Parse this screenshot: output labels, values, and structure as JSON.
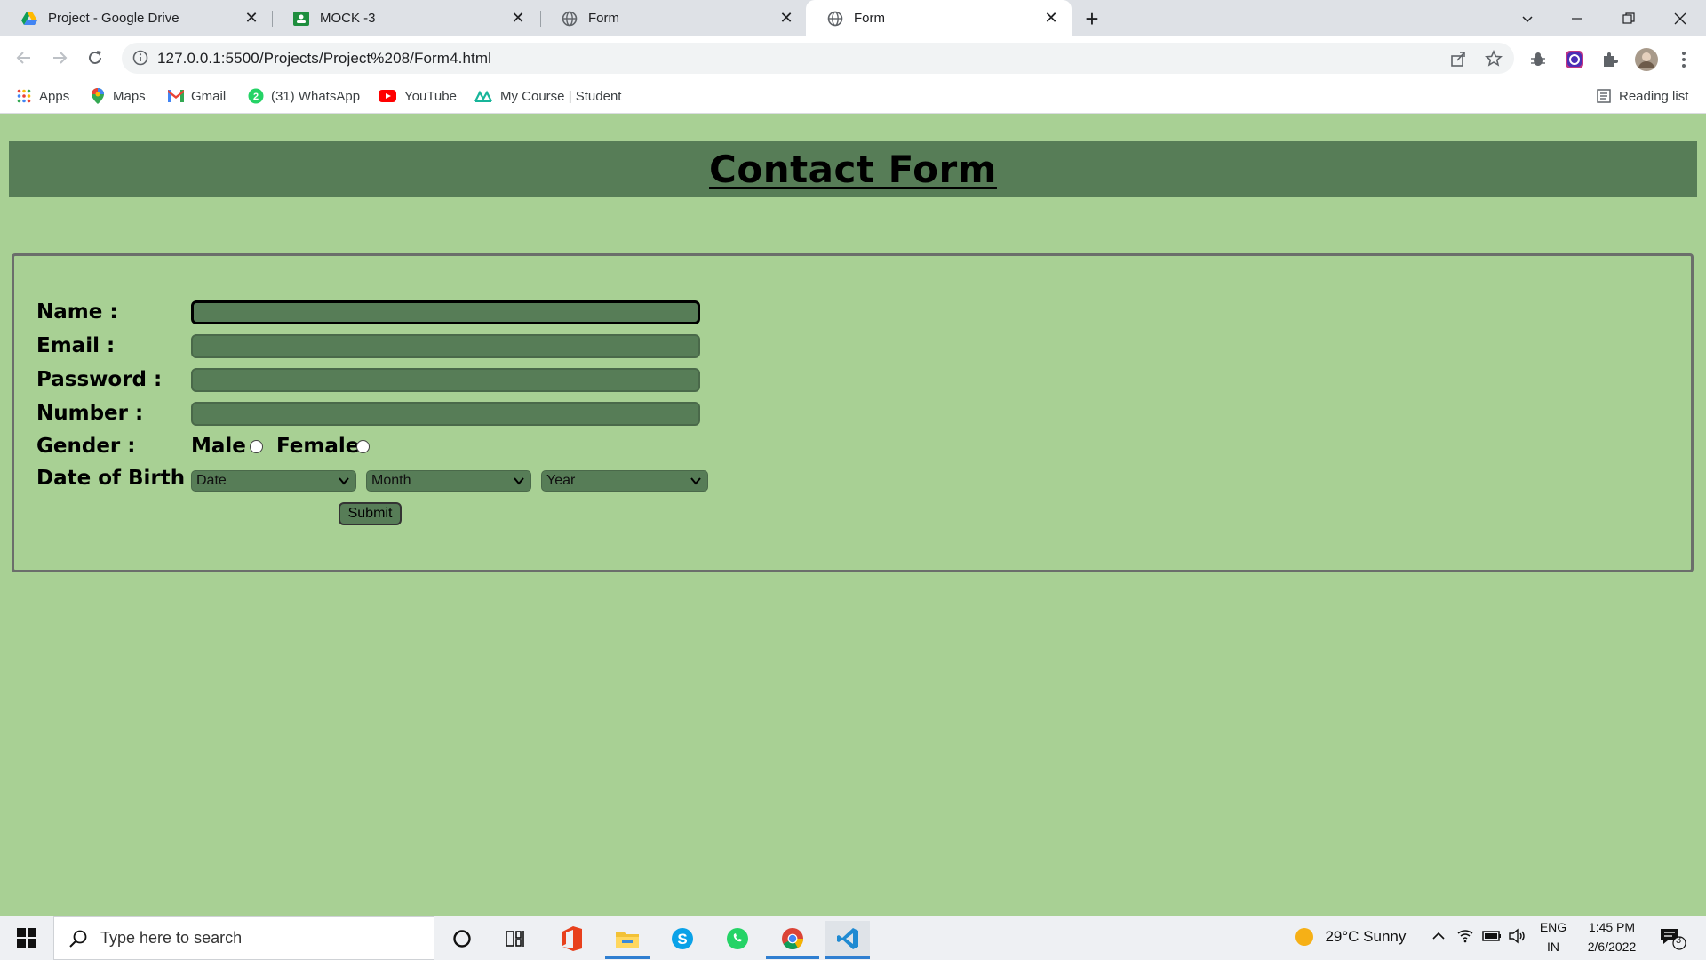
{
  "browser": {
    "tabs": [
      {
        "title": "Project - Google Drive",
        "icon": "google-drive-icon"
      },
      {
        "title": "MOCK -3",
        "icon": "google-classroom-icon"
      },
      {
        "title": "Form",
        "icon": "globe-icon"
      },
      {
        "title": "Form",
        "icon": "globe-icon",
        "active": true
      }
    ],
    "url": "127.0.0.1:5500/Projects/Project%208/Form4.html",
    "bookmarks": [
      {
        "label": "Apps",
        "icon": "apps-grid-icon"
      },
      {
        "label": "Maps",
        "icon": "maps-pin-icon"
      },
      {
        "label": "Gmail",
        "icon": "gmail-icon"
      },
      {
        "label": "(31) WhatsApp",
        "icon": "whatsapp-icon"
      },
      {
        "label": "YouTube",
        "icon": "youtube-icon"
      },
      {
        "label": "My Course | Student",
        "icon": "course-icon"
      }
    ],
    "reading_list": "Reading list"
  },
  "page": {
    "title": "Contact Form",
    "form": {
      "name_label": "Name :",
      "email_label": "Email :",
      "password_label": "Password :",
      "number_label": "Number :",
      "gender_label": "Gender :",
      "gender_options": [
        "Male",
        "Female"
      ],
      "dob_label": "Date of Birth :",
      "dob_selects": [
        "Date",
        "Month",
        "Year"
      ],
      "submit_label": "Submit"
    },
    "colors": {
      "background": "#a8d094",
      "header_bar": "#577d57",
      "field": "#577d57"
    }
  },
  "taskbar": {
    "search_placeholder": "Type here to search",
    "weather": "29°C  Sunny",
    "lang_top": "ENG",
    "lang_bottom": "IN",
    "time": "1:45 PM",
    "date": "2/6/2022",
    "notification_count": "3"
  }
}
